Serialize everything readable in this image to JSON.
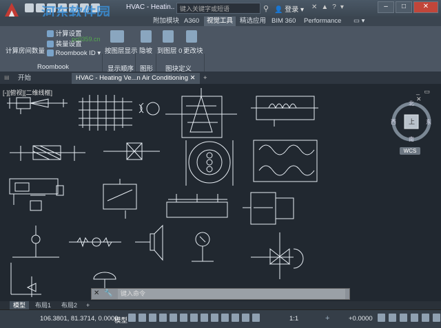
{
  "window": {
    "title": "HVAC - Heatin...",
    "search_placeholder": "键入关键字或短语",
    "user": "登录",
    "watermark": "河东软件园",
    "watermark_url": "pc0359.cn"
  },
  "ribbon_tabs": [
    "附加模块",
    "A360",
    "视觉工具",
    "精选应用",
    "BIM 360",
    "Performance"
  ],
  "active_tab": "视觉工具",
  "ribbon": {
    "calc_room": "计算房间数量",
    "calc_settings": "计算设置",
    "room_label": "装量设置",
    "roombook_id": "Roombook ID",
    "panel_roombook": "Roombook",
    "layer_display": "按图层显示",
    "panel_order": "显示顺序",
    "slope": "隐坡",
    "panel_shapes": "图形",
    "to_layer0": "到图层 0",
    "change_block": "更改块",
    "panel_blockdef": "图块定义"
  },
  "doc_tabs": [
    {
      "label": "开始"
    },
    {
      "label": "HVAC - Heating Ve...n Air Conditioning"
    }
  ],
  "viewport": {
    "label": "[-][俯视][二维线框]",
    "compass": {
      "north": "北",
      "south": "南",
      "east": "东",
      "west": "西",
      "center": "上"
    },
    "wcs": "WCS"
  },
  "command": {
    "placeholder": "键入命令"
  },
  "layout_tabs": [
    "模型",
    "布局1",
    "布局2"
  ],
  "status": {
    "coords": "106.3801, 81.3714, 0.0000",
    "model": "模型",
    "scale": "1:1",
    "angle": "+0.0000"
  }
}
